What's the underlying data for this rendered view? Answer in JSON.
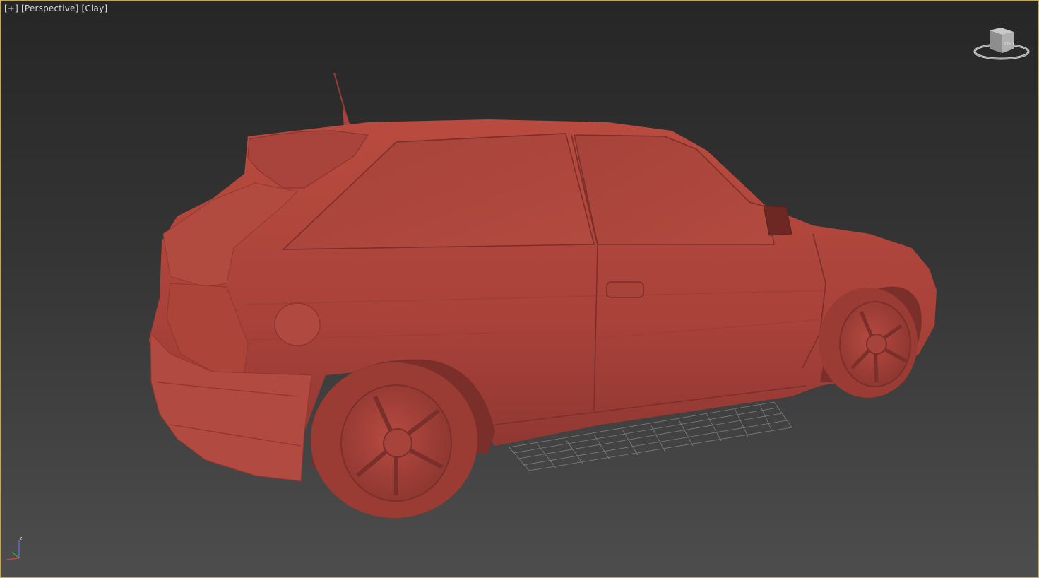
{
  "viewport": {
    "plus_menu": "[+]",
    "view_menu": "[Perspective]",
    "shading_menu": "[Clay]",
    "border_color": "#c8a84b",
    "background_top": "#262626",
    "background_bottom": "#4d4d4d"
  },
  "viewcube": {
    "face_label": "LIFT",
    "icon": "viewcube-icon"
  },
  "axis_gizmo": {
    "z_label": "z",
    "icon": "axis-tripod-icon"
  },
  "model": {
    "clay_color": "#b5473d",
    "name": "car-model"
  }
}
